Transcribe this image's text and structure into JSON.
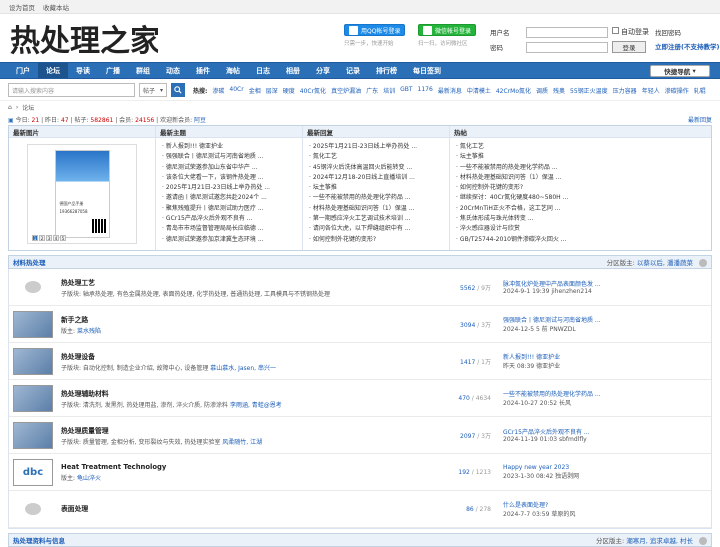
{
  "topbar": {
    "set_home": "设为首页",
    "bookmark": "收藏本站"
  },
  "header": {
    "logo_text": "热处理之家",
    "qq_login": "用QQ帐号登录",
    "qq_sub": "只需一步，快速开始",
    "wx_login": "微信帐号登录",
    "wx_sub": "扫一扫，访问微社区",
    "username_label": "用户名",
    "password_label": "密码",
    "auto_login": "自动登录",
    "login_btn": "登录",
    "forgot": "找回密码",
    "register": "立即注册(不支持教学)"
  },
  "nav": {
    "items": [
      "门户",
      "论坛",
      "导读",
      "广播",
      "群组",
      "动态",
      "插件",
      "海帖",
      "日志",
      "相册",
      "分享",
      "记录",
      "排行榜",
      "每日签到"
    ],
    "active": 1,
    "quick": "快捷导航"
  },
  "search": {
    "placeholder": "请输入搜索内容",
    "select": "帖子",
    "hot_label": "热搜:",
    "hot": [
      "渗碳",
      "40Cr",
      "金相",
      "层深",
      "硬度",
      "40Cr氮化",
      "真空炉漏油",
      "广东",
      "培训",
      "GBT",
      "1176",
      "最新消息",
      "中清模土",
      "42CrMo氮化",
      "调质",
      "残奥",
      "55钢正火温度",
      "压力容器",
      "年轻人",
      "渗碳操作",
      "轧辊"
    ]
  },
  "crumb": {
    "forum": "论坛"
  },
  "stats": {
    "today_label": "今日:",
    "today": "21",
    "yesterday_label": "昨日:",
    "yesterday": "47",
    "posts_label": "帖子:",
    "posts": "582861",
    "members_label": "会员:",
    "members": "24156",
    "welcome_label": "欢迎新会员:",
    "welcome": "阿豆",
    "latest_reply": "最新回复"
  },
  "panels": {
    "images": {
      "title": "最新图片",
      "poster_t1": "德国产品手册",
      "poster_t2": "19366287058",
      "pages": [
        "1",
        "2",
        "3",
        "4",
        "5"
      ]
    },
    "topics": {
      "title": "最新主题",
      "items": [
        "新人报到!!! 德亚护业",
        "强强联合丨德尼测试与河南省地质 ...",
        "德尼测试荣邀参加山东省中华产 ...",
        "该条位大佬看一下，该钢件热处理 ...",
        "2025年1月21日-23日线上举办热处 ...",
        "邀请函丨德尼测试邀您共赴2024个 ...",
        "聚焦残殖提升丨德尼测试助力医疗 ...",
        "GCr15产品淬火后外观不良有 ...",
        "青岛市市场监督管理局局长应临德 ...",
        "德尼测试荣邀参加京津冀生态环境 ..."
      ]
    },
    "replies": {
      "title": "最新回复",
      "items": [
        "2025年1月21日-23日线上举办热处 ...",
        "氮化工艺",
        "45钢淬火后洗体高温回火后能转变 ...",
        "2024年12月18-20日线上直播培训 ...",
        "坛主筝推",
        "一些不能被禁用的热处理化学药品 ...",
        "材料热处理基础知识问答（1）保温 ...",
        "第一期感应淬火工艺调试技术培训 ...",
        "请问各位大虎，以下焊缝组织中有 ...",
        "如何控制外花键的变形?"
      ]
    },
    "hot": {
      "title": "热帖",
      "items": [
        "氮化工艺",
        "坛主筝推",
        "一些不能被禁用的热处理化学药品 ...",
        "材料热处理基础知识问答（1）保温 ...",
        "如何控制外花键的变形?",
        "继续探讨：40Cr氮化硬度480~580H ...",
        "20CrMnTiH正火不合格，这工艺同 ...",
        "焦氏体形成与珠光体转变 ...",
        "淬火感应器设计与欣赏",
        "GB/T25744-2010钢件渗碳淬火回火 ..."
      ]
    }
  },
  "section1": {
    "title": "材料热处理",
    "mod_label": "分区版主:",
    "mods": "以蔡以后, 潘潘蔬菜"
  },
  "forums": [
    {
      "name": "热处理工艺",
      "sub": "子版块: 轴承热处理, 有色金属热处理, 表面热处理, 化学热处理, 普通热处理, 工具模具与不锈钢热处理",
      "mods": "",
      "topics": "5562",
      "posts": "9万",
      "last_title": "脉冲氮化炉处理中产品表面颜色发 ...",
      "last_meta": "2024-9-1 19:39 jihenzhen214",
      "icon": "bubble"
    },
    {
      "name": "新手之路",
      "sub": "版主:",
      "mods": "菜水残陷",
      "topics": "3094",
      "posts": "3万",
      "last_title": "强强联合丨德尼测试与河南省地质 ...",
      "last_meta": "2024-12-5 5 前 PNWZDL",
      "icon": "thumb"
    },
    {
      "name": "热处理设备",
      "sub": "子版块: 自动化控制, 制造企业介绍, 故障中心, 设备管理",
      "mods": "慕山慕水, Jasen, 串兴一",
      "topics": "1417",
      "posts": "1万",
      "last_title": "新人报到!!! 德亚护业",
      "last_meta": "昨天 08:39 德亚护业",
      "icon": "thumb"
    },
    {
      "name": "热处理辅助材料",
      "sub": "子版块: 清洗剂, 发黑剂, 热处理用盐, 渗剂, 淬火介质, 防渗涂料",
      "mods": "李雨涵, 青蛙@恩考",
      "topics": "470",
      "posts": "4634",
      "last_title": "一些不能被禁用的热处理化学药品 ...",
      "last_meta": "2024-10-27 20:52 长风",
      "icon": "thumb"
    },
    {
      "name": "热处理质量管理",
      "sub": "子版块: 质量管理, 金相分析, 变形裂纹与失效, 热处理实验室",
      "mods": "风柔随竹, 江湖",
      "topics": "2097",
      "posts": "3万",
      "last_title": "GCr15产品淬火后外观不良有 ...",
      "last_meta": "2024-11-19 01:03 sbfmdlfly",
      "icon": "thumb"
    },
    {
      "name": "Heat Treatment Technology",
      "sub": "版主:",
      "mods": "龟山淬火",
      "topics": "192",
      "posts": "1213",
      "last_title": "Happy new year 2023",
      "last_meta": "2023-1-30 08:42 独语剥网",
      "icon": "dbc"
    },
    {
      "name": "表面处理",
      "sub": "",
      "mods": "",
      "topics": "86",
      "posts": "278",
      "last_title": "什么是表面处理?",
      "last_meta": "2024-7-7 03:59 草原的风",
      "icon": "bubble"
    }
  ],
  "section2": {
    "title": "热处理资料与信息",
    "mod_label": "分区版主:",
    "mods": "潮寒月, 追求卓越, 村长"
  }
}
